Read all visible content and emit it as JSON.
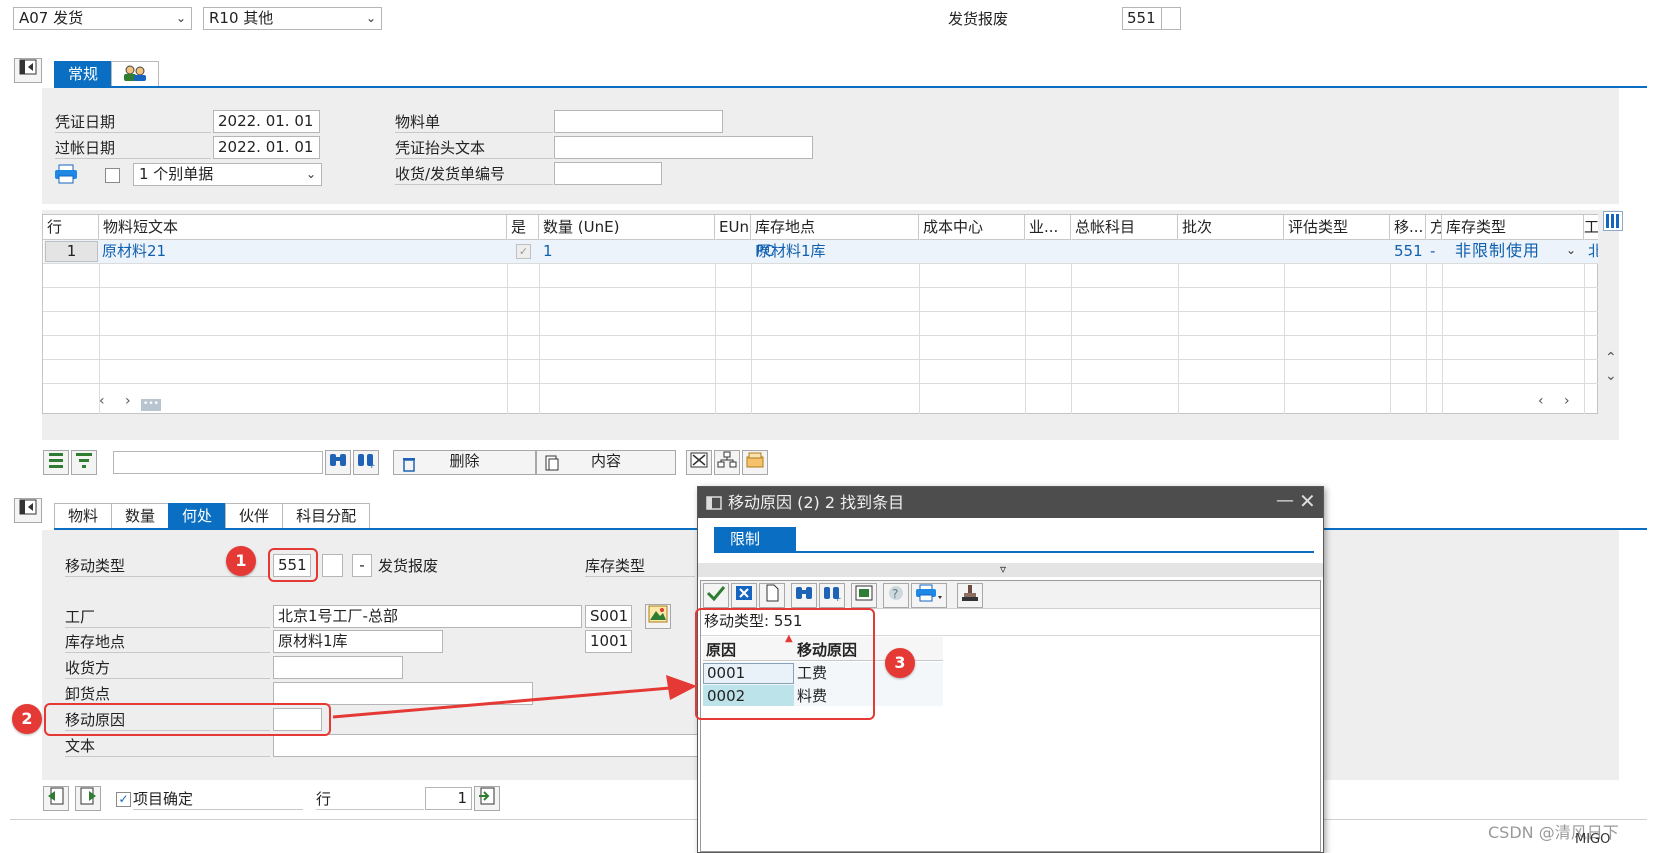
{
  "header": {
    "movement_select": "A07 发货",
    "reference_select": "R10 其他",
    "movement_desc": "发货报废",
    "movement_type": "551"
  },
  "top_tabs": {
    "general": "常规"
  },
  "doc_header": {
    "doc_date_label": "凭证日期",
    "doc_date": "2022. 01. 01",
    "post_date_label": "过帐日期",
    "post_date": "2022. 01. 01",
    "print_select": "1 个别单据",
    "material_slip_label": "物料单",
    "header_text_label": "凭证抬头文本",
    "gr_gi_slip_label": "收货/发货单编号"
  },
  "items_table": {
    "columns": [
      "行",
      "物料短文本",
      "是",
      "数量 (UnE)",
      "EUn",
      "库存地点",
      "成本中心",
      "业...",
      "总帐科目",
      "批次",
      "评估类型",
      "移...",
      "方",
      "库存类型",
      "工"
    ],
    "rows": [
      {
        "line": "1",
        "material": "原材料21",
        "qty": "1",
        "unit": "PC",
        "sloc": "原材料1库",
        "mvt": "551",
        "dir": "-",
        "stock_type": "非限制使用",
        "extra": "北"
      }
    ]
  },
  "item_toolbar": {
    "delete_label": "删除",
    "contents_label": "内容"
  },
  "detail_tabs": [
    "物料",
    "数量",
    "何处",
    "伙伴",
    "科目分配"
  ],
  "detail": {
    "mvt_type_label": "移动类型",
    "mvt_type": "551",
    "minus": "-",
    "mvt_desc": "发货报废",
    "stock_type_label": "库存类型",
    "plant_label": "工厂",
    "plant_name": "北京1号工厂-总部",
    "plant_code": "S001",
    "sloc_label": "库存地点",
    "sloc_name": "原材料1库",
    "sloc_code": "1001",
    "recipient_label": "收货方",
    "unloading_label": "卸货点",
    "reason_label": "移动原因",
    "text_label": "文本"
  },
  "footer": {
    "item_ok_label": "项目确定",
    "line_label": "行",
    "line_value": "1",
    "watermark": "CSDN @清风日下",
    "transaction": "MIGO"
  },
  "dialog": {
    "title": "移动原因 (2)    2 找到条目",
    "tab_label": "限制",
    "criteria": "移动类型: 551",
    "col_reason": "原因",
    "col_desc": "移动原因",
    "rows": [
      {
        "code": "0001",
        "desc": "工费"
      },
      {
        "code": "0002",
        "desc": "料费"
      }
    ]
  },
  "annotations": {
    "badge1": "1",
    "badge2": "2",
    "badge3": "3"
  },
  "colors": {
    "accent": "#0a6fc2",
    "highlight": "#e53935",
    "panel": "#eeeeee"
  }
}
